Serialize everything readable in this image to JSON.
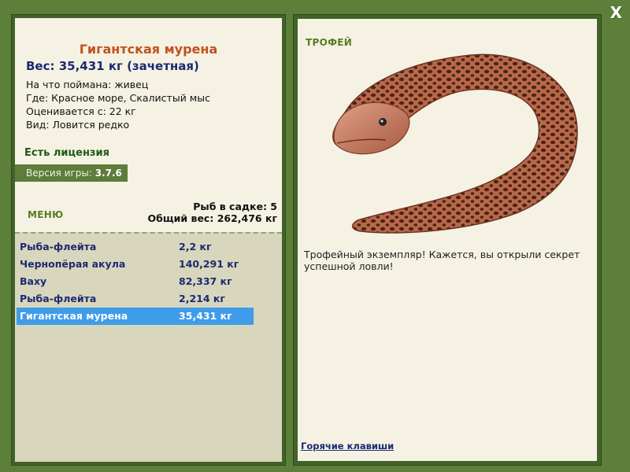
{
  "window": {
    "close_label": "X"
  },
  "fish": {
    "title": "Гигантская мурена",
    "weight_line": "Вес: 35,431 кг (зачетная)",
    "info": [
      "На что поймана: живец",
      "Где: Красное море, Скалистый мыс",
      "Оценивается с: 22 кг",
      "Вид: Ловится редко"
    ]
  },
  "license": "Есть лицензия",
  "version": {
    "label": "Версия игры:",
    "value": "3.7.6"
  },
  "menu_label": "МЕНЮ",
  "cage": {
    "count_line": "Рыб в садке: 5",
    "total_line": "Общий вес: 262,476 кг"
  },
  "catch_list": [
    {
      "name": "Рыба-флейта",
      "weight": "2,2 кг",
      "selected": false
    },
    {
      "name": "Чернопёрая акула",
      "weight": "140,291 кг",
      "selected": false
    },
    {
      "name": "Ваху",
      "weight": "82,337 кг",
      "selected": false
    },
    {
      "name": "Рыба-флейта",
      "weight": "2,214 кг",
      "selected": false
    },
    {
      "name": "Гигантская мурена",
      "weight": "35,431 кг",
      "selected": true
    }
  ],
  "trophy": {
    "label": "ТРОФЕЙ",
    "text": "Трофейный экземпляр! Кажется, вы открыли секрет успешной ловли!"
  },
  "hotkeys_label": "Горячие клавиши",
  "colors": {
    "frame": "#5c7f3a",
    "panel_bg": "#f5f2e3",
    "list_bg": "#d8d6bc",
    "selected": "#3f9ce8",
    "title": "#c0521e",
    "navy": "#1b2a72"
  }
}
